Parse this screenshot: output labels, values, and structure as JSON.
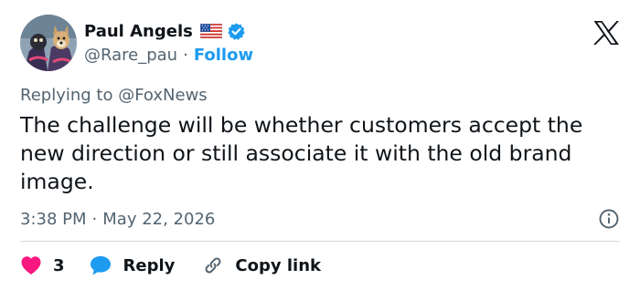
{
  "user": {
    "display_name": "Paul Angels",
    "handle": "@Rare_pau",
    "separator": "·",
    "follow_label": "Follow",
    "avatar_icon": "dog-avatar-icon",
    "flag_icon": "us-flag-icon",
    "verified_icon": "verified-badge-icon"
  },
  "reply_context": {
    "prefix": "Replying to",
    "mention": "@FoxNews"
  },
  "tweet": {
    "text": "The challenge will be whether customers accept the new direction or still associate it with the old brand image.",
    "time": "3:38 PM",
    "separator": "·",
    "date": "May 22, 2026"
  },
  "actions": {
    "like_count": "3",
    "reply_label": "Reply",
    "copy_link_label": "Copy link"
  },
  "colors": {
    "accent": "#1d9bf0",
    "like": "#f91880",
    "text_primary": "#0f1419",
    "text_secondary": "#536471",
    "divider": "#cfd9de"
  }
}
